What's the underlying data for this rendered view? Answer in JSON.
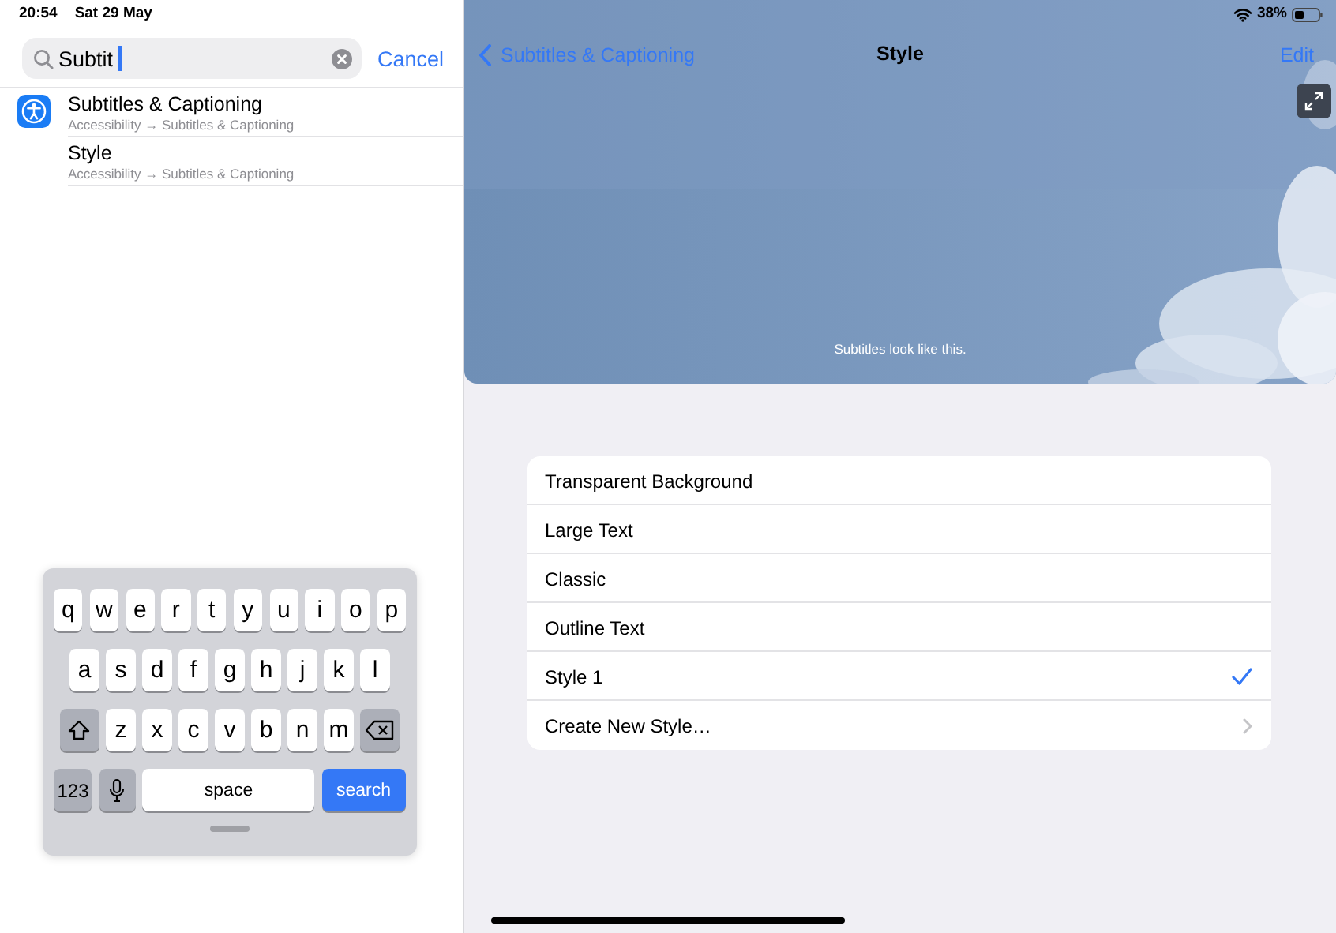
{
  "status_bar": {
    "time": "20:54",
    "date": "Sat 29 May",
    "battery": "38%"
  },
  "search": {
    "value": "Subtit",
    "cancel": "Cancel"
  },
  "results": [
    {
      "kind": "with_icon",
      "title": "Subtitles & Captioning",
      "path": "Accessibility → Subtitles & Captioning"
    },
    {
      "kind": "plain",
      "title": "Style",
      "path": "Accessibility → Subtitles & Captioning"
    }
  ],
  "nav": {
    "back": "Subtitles & Captioning",
    "title": "Style",
    "action": "Edit"
  },
  "preview": {
    "subtitle": "Subtitles look like this."
  },
  "styles": [
    {
      "kind": "option",
      "label": "Transparent Background",
      "selected": false
    },
    {
      "kind": "option",
      "label": "Large Text",
      "selected": false
    },
    {
      "kind": "option",
      "label": "Classic",
      "selected": false
    },
    {
      "kind": "option",
      "label": "Outline Text",
      "selected": false
    },
    {
      "kind": "option",
      "label": "Style 1",
      "selected": true
    },
    {
      "kind": "link",
      "label": "Create New Style…",
      "selected": false
    }
  ],
  "keyboard": {
    "rows": [
      [
        "q",
        "w",
        "e",
        "r",
        "t",
        "y",
        "u",
        "i",
        "o",
        "p"
      ],
      [
        "a",
        "s",
        "d",
        "f",
        "g",
        "h",
        "j",
        "k",
        "l"
      ],
      [
        "z",
        "x",
        "c",
        "v",
        "b",
        "n",
        "m"
      ]
    ],
    "numbers_key": "123",
    "space_key": "space",
    "return_key": "search"
  }
}
